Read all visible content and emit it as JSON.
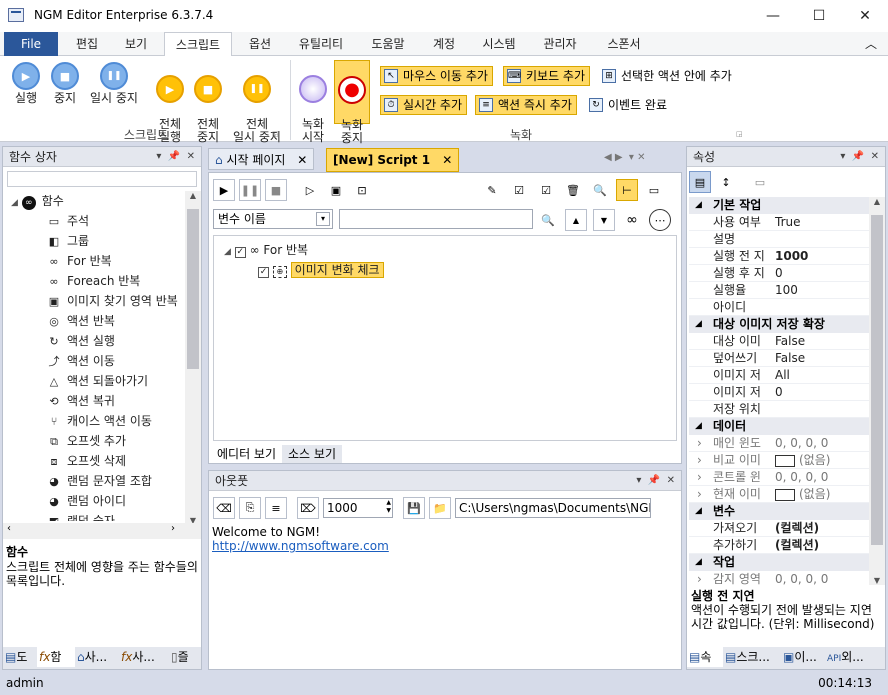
{
  "window": {
    "title": "NGM Editor  Enterprise 6.3.7.4",
    "min": "—",
    "max": "☐",
    "close": "✕"
  },
  "menu": {
    "items": [
      "File",
      "편집",
      "보기",
      "스크립트",
      "옵션",
      "유틸리티",
      "도움말",
      "계정",
      "시스템",
      "관리자",
      "스폰서"
    ],
    "active": "스크립트",
    "collapse": "︿"
  },
  "ribbon": {
    "group1": {
      "name": "스크립트",
      "buttons": [
        {
          "label": "실행",
          "glyph": "▶"
        },
        {
          "label": "중지",
          "glyph": "■"
        },
        {
          "label": "일시 중지",
          "glyph": "❚❚"
        },
        {
          "label": "전체\n실행",
          "glyph": "▶"
        },
        {
          "label": "전체\n중지",
          "glyph": "■"
        },
        {
          "label": "전체\n일시 중지",
          "glyph": "❚❚"
        }
      ]
    },
    "group2": {
      "name": "녹화",
      "buttons": [
        {
          "label": "녹화\n시작",
          "glyph": "○"
        },
        {
          "label": "녹화\n중지",
          "glyph": "●"
        }
      ],
      "small": [
        {
          "label": "마우스 이동 추가",
          "glyph": "↖"
        },
        {
          "label": "키보드 추가",
          "glyph": "⌨"
        },
        {
          "label": "선택한 액션 안에 추가",
          "glyph": "⊞"
        },
        {
          "label": "실시간 추가",
          "glyph": "⏱"
        },
        {
          "label": "액션 즉시 추가",
          "glyph": "≡"
        },
        {
          "label": "이벤트 완료",
          "glyph": "↻"
        }
      ]
    }
  },
  "left_panel": {
    "title": "함수 상자",
    "root": "함수",
    "items": [
      {
        "label": "주석",
        "glyph": "▭"
      },
      {
        "label": "그룹",
        "glyph": "◧"
      },
      {
        "label": "For 반복",
        "glyph": "∞"
      },
      {
        "label": "Foreach 반복",
        "glyph": "∞"
      },
      {
        "label": "이미지 찾기 영역 반복",
        "glyph": "▣"
      },
      {
        "label": "액션 반복",
        "glyph": "◎"
      },
      {
        "label": "액션 실행",
        "glyph": "↻"
      },
      {
        "label": "액션 이동",
        "glyph": "⤴"
      },
      {
        "label": "액션 되돌아가기",
        "glyph": "△"
      },
      {
        "label": "액션 복귀",
        "glyph": "⟲"
      },
      {
        "label": "캐이스 액션 이동",
        "glyph": "⑂"
      },
      {
        "label": "오프셋 추가",
        "glyph": "⧉"
      },
      {
        "label": "오프셋 삭제",
        "glyph": "⧈"
      },
      {
        "label": "랜덤 문자열 조합",
        "glyph": "◕"
      },
      {
        "label": "랜덤 아이디",
        "glyph": "◕"
      },
      {
        "label": "랜덤 숫자",
        "glyph": "◩"
      }
    ],
    "desc_title": "함수",
    "desc_text": "스크립트 전체에 영향을 주는 함수들의 목록입니다.",
    "bottom_tabs": [
      "도",
      "함",
      "사...",
      "사...",
      "즐"
    ]
  },
  "editor": {
    "tabs": [
      {
        "label": "시작 페이지",
        "active": false
      },
      {
        "label": "[New] Script 1",
        "active": true
      }
    ],
    "var_select": "변수 이름",
    "var_search": "",
    "tree": [
      {
        "label": "For 반복",
        "level": 0
      },
      {
        "label": "이미지 변화 체크",
        "level": 1
      }
    ],
    "view_tabs": [
      "에디터 보기",
      "소스 보기"
    ]
  },
  "output": {
    "title": "아웃풋",
    "count": "1000",
    "path": "C:\\Users\\ngmas\\Documents\\NGM6\\",
    "line1": "Welcome to NGM!",
    "link": "http://www.ngmsoftware.com"
  },
  "properties": {
    "title": "속성",
    "rows": [
      {
        "type": "cat",
        "name": "기본 작업"
      },
      {
        "type": "prop",
        "name": "사용 여부",
        "value": "True"
      },
      {
        "type": "prop",
        "name": "설명",
        "value": ""
      },
      {
        "type": "prop",
        "name": "실행 전 지",
        "value": "1000",
        "bold": true
      },
      {
        "type": "prop",
        "name": "실행 후 지",
        "value": "0"
      },
      {
        "type": "prop",
        "name": "실행율",
        "value": "100"
      },
      {
        "type": "prop",
        "name": "아이디",
        "value": ""
      },
      {
        "type": "cat",
        "name": "대상 이미지 저장 확장"
      },
      {
        "type": "prop",
        "name": "대상 이미",
        "value": "False"
      },
      {
        "type": "prop",
        "name": "덮어쓰기",
        "value": "False"
      },
      {
        "type": "prop",
        "name": "이미지 저",
        "value": "All"
      },
      {
        "type": "prop",
        "name": "이미지 저",
        "value": "0"
      },
      {
        "type": "prop",
        "name": "저장 위치",
        "value": ""
      },
      {
        "type": "cat",
        "name": "데이터"
      },
      {
        "type": "prop",
        "name": "매인 윈도",
        "value": "0, 0, 0, 0",
        "exp": true
      },
      {
        "type": "prop",
        "name": "비교 이미",
        "value": "(없음)",
        "exp": true,
        "box": true
      },
      {
        "type": "prop",
        "name": "콘트롤 윈",
        "value": "0, 0, 0, 0",
        "exp": true
      },
      {
        "type": "prop",
        "name": "현재 이미",
        "value": "(없음)",
        "exp": true,
        "box": true
      },
      {
        "type": "cat",
        "name": "변수"
      },
      {
        "type": "prop",
        "name": "가져오기",
        "value": "(컬렉션)",
        "bold": true
      },
      {
        "type": "prop",
        "name": "추가하기",
        "value": "(컬렉션)",
        "bold": true
      },
      {
        "type": "cat",
        "name": "작업"
      },
      {
        "type": "prop",
        "name": "감지 영역",
        "value": "0, 0, 0, 0",
        "exp": true
      }
    ],
    "desc_title": "실행 전 지연",
    "desc_text": "액션이 수행되기 전에 발생되는 지연 시간 값입니다. (단위: Millisecond)",
    "bottom_tabs": [
      "속",
      "스크...",
      "이...",
      "외..."
    ]
  },
  "status": {
    "user": "admin",
    "time": "00:14:13"
  }
}
